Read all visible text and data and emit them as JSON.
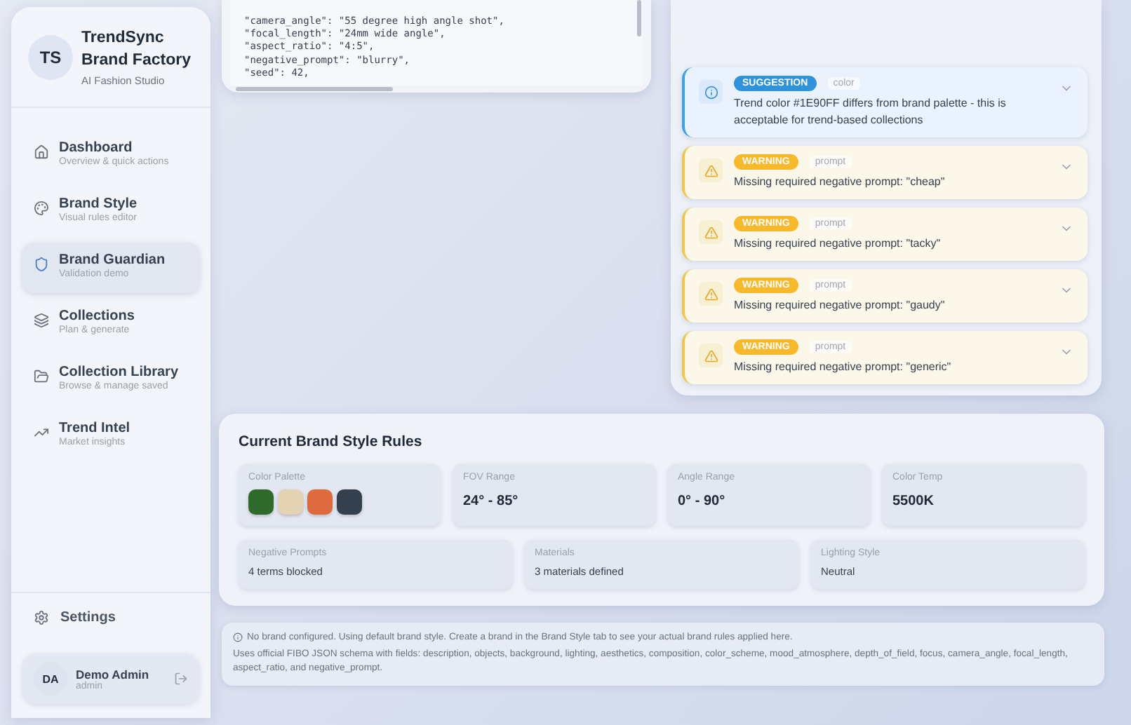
{
  "sidebar": {
    "logo_initials": "TS",
    "brand_name": "TrendSync Brand Factory",
    "tagline": "AI Fashion Studio",
    "items": [
      {
        "kind": "home",
        "label": "Dashboard",
        "sub": "Overview & quick actions",
        "selected": false
      },
      {
        "kind": "palette",
        "label": "Brand Style",
        "sub": "Visual rules editor",
        "selected": false
      },
      {
        "kind": "shield",
        "label": "Brand Guardian",
        "sub": "Validation demo",
        "selected": true
      },
      {
        "kind": "layers",
        "label": "Collections",
        "sub": "Plan & generate",
        "selected": false
      },
      {
        "kind": "folder",
        "label": "Collection Library",
        "sub": "Browse & manage saved",
        "selected": false
      },
      {
        "kind": "trend",
        "label": "Trend Intel",
        "sub": "Market insights",
        "selected": false
      }
    ],
    "settings": "Settings",
    "user": {
      "initials": "DA",
      "name": "Demo Admin",
      "role": "admin"
    }
  },
  "code_lines": [
    "\"camera_angle\": \"55 degree high angle shot\",",
    "\"focal_length\": \"24mm wide angle\",",
    "\"aspect_ratio\": \"4:5\",",
    "\"negative_prompt\": \"blurry\",",
    "\"seed\": 42,"
  ],
  "issues": [
    {
      "kind": "suggestion",
      "badge": "SUGGESTION",
      "category": "color",
      "message": "Trend color #1E90FF differs from brand palette - this is acceptable for trend-based collections"
    },
    {
      "kind": "warning",
      "badge": "WARNING",
      "category": "prompt",
      "message": "Missing required negative prompt: \"cheap\""
    },
    {
      "kind": "warning",
      "badge": "WARNING",
      "category": "prompt",
      "message": "Missing required negative prompt: \"tacky\""
    },
    {
      "kind": "warning",
      "badge": "WARNING",
      "category": "prompt",
      "message": "Missing required negative prompt: \"gaudy\""
    },
    {
      "kind": "warning",
      "badge": "WARNING",
      "category": "prompt",
      "message": "Missing required negative prompt: \"generic\""
    }
  ],
  "rules": {
    "title": "Current Brand Style Rules",
    "palette": {
      "label": "Color Palette",
      "swatches": [
        {
          "color": "#2f6a2a"
        },
        {
          "color": "#e3d3b3"
        },
        {
          "color": "#dd6a3c"
        },
        {
          "color": "#34404d"
        }
      ]
    },
    "stats": [
      {
        "label": "FOV Range",
        "value": "24° - 85°"
      },
      {
        "label": "Angle Range",
        "value": "0° - 90°"
      },
      {
        "label": "Color Temp",
        "value": "5500K"
      }
    ],
    "details": [
      {
        "label": "Negative Prompts",
        "value": "4 terms blocked"
      },
      {
        "label": "Materials",
        "value": "3 materials defined"
      },
      {
        "label": "Lighting Style",
        "value": "Neutral"
      }
    ]
  },
  "note": {
    "notice": "No brand configured. Using default brand style. Create a brand in the Brand Style tab to see your actual brand rules applied here.",
    "schema": "Uses official FIBO JSON schema with fields: description, objects, background, lighting, aesthetics, composition, color_scheme, mood_atmosphere, depth_of_field, focus, camera_angle, focal_length, aspect_ratio, and negative_prompt."
  }
}
